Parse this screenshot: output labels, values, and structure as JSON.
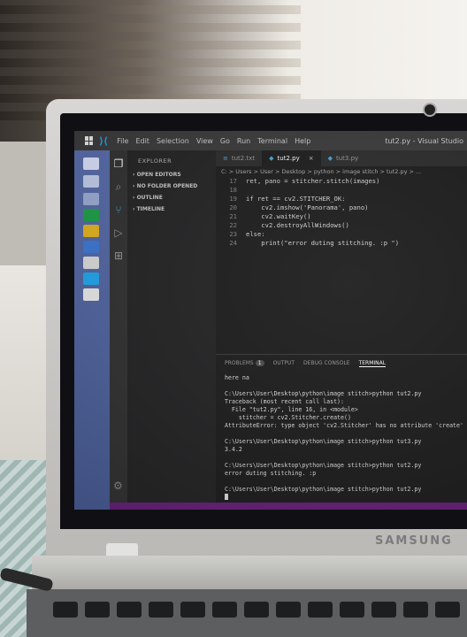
{
  "window": {
    "title": "tut2.py - Visual Studio",
    "menu": [
      "File",
      "Edit",
      "Selection",
      "View",
      "Go",
      "Run",
      "Terminal",
      "Help"
    ]
  },
  "explorer": {
    "header": "EXPLORER",
    "sections": [
      "OPEN EDITORS",
      "NO FOLDER OPENED",
      "OUTLINE",
      "TIMELINE"
    ]
  },
  "tabs": [
    {
      "label": "tut2.txt",
      "active": false
    },
    {
      "label": "tut2.py",
      "active": true,
      "close": "×"
    },
    {
      "label": "tut3.py",
      "active": false
    }
  ],
  "breadcrumb": "C: > Users > User > Desktop > python > image stitch > tut2.py > ...",
  "code_lines": [
    {
      "num": "17",
      "text": "ret, pano = stitcher.stitch(images)"
    },
    {
      "num": "18",
      "text": ""
    },
    {
      "num": "19",
      "text": "if ret == cv2.STITCHER_OK:"
    },
    {
      "num": "20",
      "text": "    cv2.imshow('Panorama', pano)"
    },
    {
      "num": "21",
      "text": "    cv2.waitKey()"
    },
    {
      "num": "22",
      "text": "    cv2.destroyAllWindows()"
    },
    {
      "num": "23",
      "text": "else:"
    },
    {
      "num": "24",
      "text": "    print(\"error duting stitching. :p \")"
    }
  ],
  "panel": {
    "tabs": [
      "PROBLEMS",
      "OUTPUT",
      "DEBUG CONSOLE",
      "TERMINAL"
    ],
    "problems_count": "1",
    "terminal_lines": [
      "here na",
      "",
      "C:\\Users\\User\\Desktop\\python\\image stitch>python tut2.py",
      "Traceback (most recent call last):",
      "  File \"tut2.py\", line 16, in <module>",
      "    stitcher = cv2.Stitcher.create()",
      "AttributeError: type object 'cv2.Stitcher' has no attribute 'create'",
      "",
      "C:\\Users\\User\\Desktop\\python\\image stitch>python tut3.py",
      "3.4.2",
      "",
      "C:\\Users\\User\\Desktop\\python\\image stitch>python tut2.py",
      "error duting stitching. :p",
      "",
      "C:\\Users\\User\\Desktop\\python\\image stitch>python tut2.py"
    ]
  },
  "brand": "SAMSUNG",
  "colors": {
    "status_bar": "#68217a",
    "editor_bg": "#1e1e1e",
    "taskbar": "#5a6fae"
  },
  "icons": [
    "windows-logo-icon",
    "vscode-logo-icon",
    "files-icon",
    "search-icon",
    "source-control-icon",
    "run-debug-icon",
    "extensions-icon",
    "gear-icon"
  ]
}
